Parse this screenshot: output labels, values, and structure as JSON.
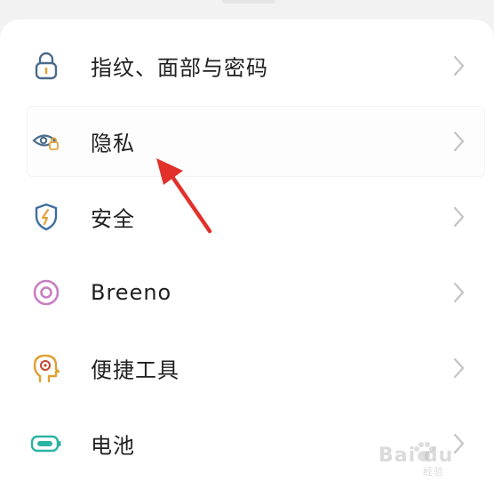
{
  "settings": {
    "items": [
      {
        "label": "指纹、面部与密码",
        "icon": "lock-icon"
      },
      {
        "label": "隐私",
        "icon": "privacy-eye-icon"
      },
      {
        "label": "安全",
        "icon": "shield-bolt-icon"
      },
      {
        "label": "Breeno",
        "icon": "breeno-ring-icon"
      },
      {
        "label": "便捷工具",
        "icon": "head-bulb-icon"
      },
      {
        "label": "电池",
        "icon": "battery-icon"
      }
    ]
  },
  "watermark": {
    "text": "Bai du",
    "sub": "经验"
  },
  "colors": {
    "lock": "#4a6b8a",
    "privacy": "#4a6b8a",
    "shield": "#3d6e9e",
    "breeno": "#c77fc0",
    "tools": "#e0a030",
    "battery": "#2bb3a3",
    "arrow": "#e2312b",
    "chevron": "#c4c4c4"
  }
}
